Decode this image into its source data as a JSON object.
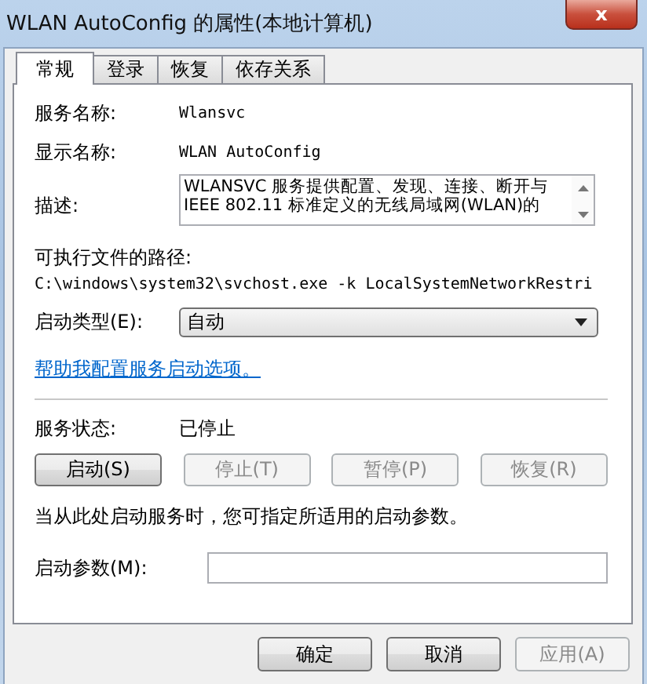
{
  "window": {
    "title": "WLAN AutoConfig 的属性(本地计算机)",
    "close_symbol": "x"
  },
  "tabs": [
    {
      "label": "常规",
      "selected": true
    },
    {
      "label": "登录",
      "selected": false
    },
    {
      "label": "恢复",
      "selected": false
    },
    {
      "label": "依存关系",
      "selected": false
    }
  ],
  "service_name": {
    "label": "服务名称:",
    "value": "Wlansvc"
  },
  "display_name": {
    "label": "显示名称:",
    "value": "WLAN AutoConfig"
  },
  "description": {
    "label": "描述:",
    "lines": [
      "WLANSVC 服务提供配置、发现、连接、断开与",
      "IEEE 802.11 标准定义的无线局域网(WLAN)的"
    ]
  },
  "executable_path": {
    "label": "可执行文件的路径:",
    "value": "C:\\windows\\system32\\svchost.exe -k LocalSystemNetworkRestri"
  },
  "startup_type": {
    "label": "启动类型(E):",
    "value": "自动"
  },
  "help_link": "帮助我配置服务启动选项。",
  "service_status": {
    "label": "服务状态:",
    "value": "已停止"
  },
  "control_buttons": [
    {
      "label": "启动(S)",
      "disabled": false
    },
    {
      "label": "停止(T)",
      "disabled": true
    },
    {
      "label": "暂停(P)",
      "disabled": true
    },
    {
      "label": "恢复(R)",
      "disabled": true
    }
  ],
  "note": "当从此处启动服务时，您可指定所适用的启动参数。",
  "start_parameters": {
    "label": "启动参数(M):"
  },
  "dialog_buttons": [
    {
      "label": "确定",
      "disabled": false
    },
    {
      "label": "取消",
      "disabled": false
    },
    {
      "label": "应用(A)",
      "disabled": true
    }
  ]
}
